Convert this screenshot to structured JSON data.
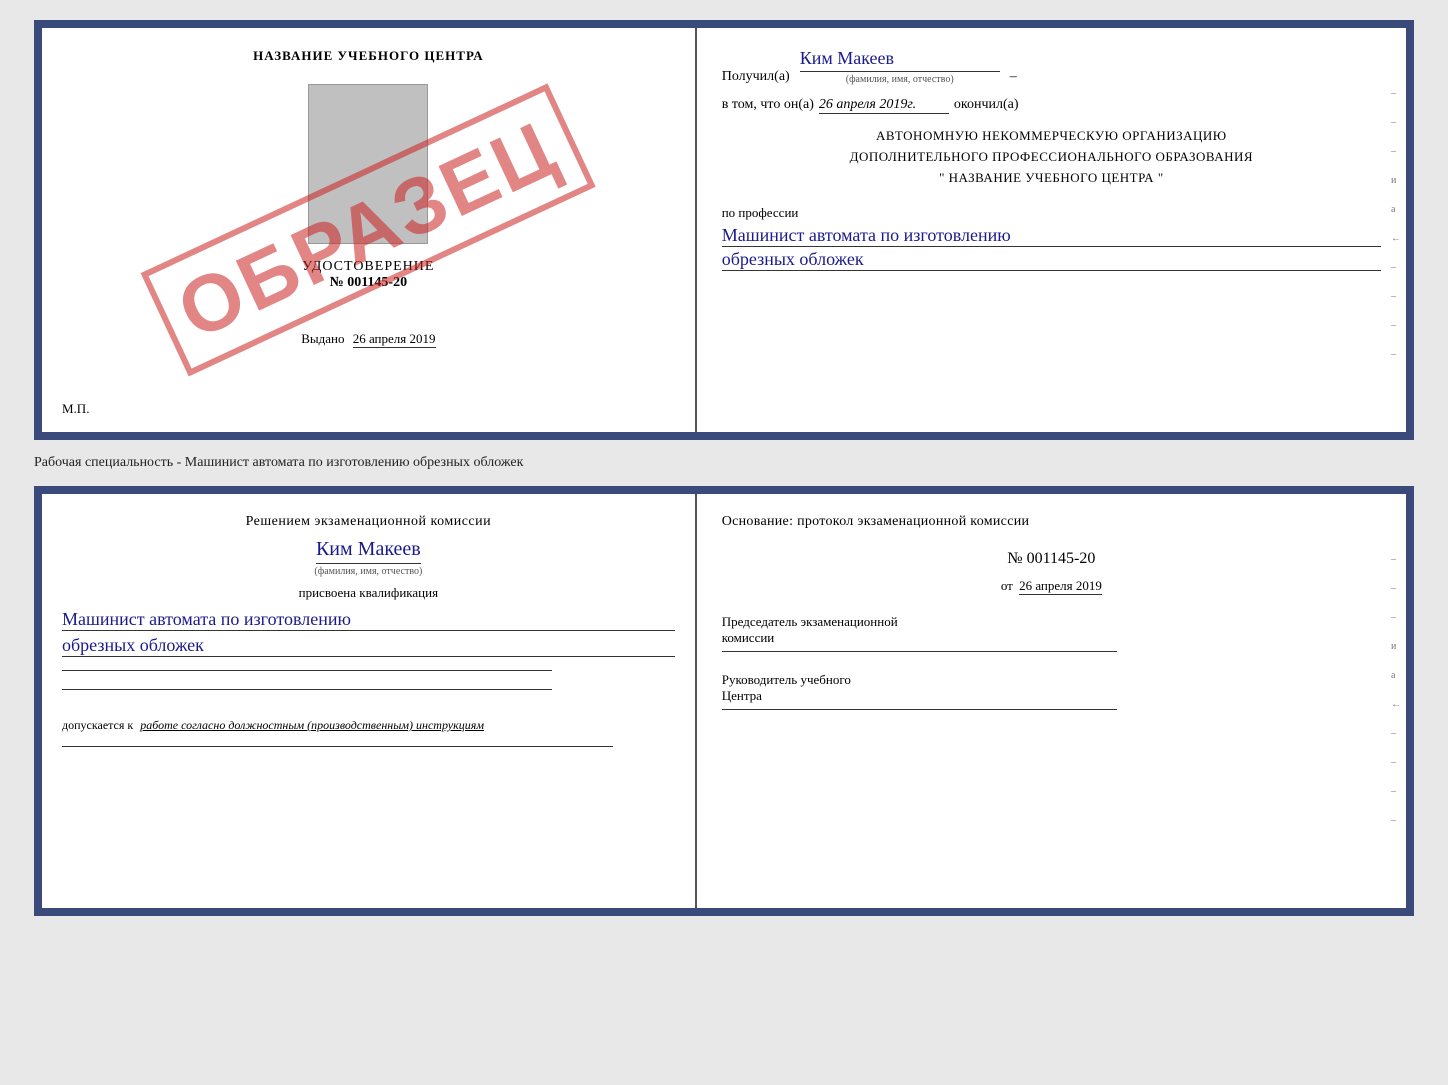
{
  "top_cert": {
    "left": {
      "school_name": "НАЗВАНИЕ УЧЕБНОГО ЦЕНТРА",
      "photo_alt": "Фото",
      "udostoverenie_title": "УДОСТОВЕРЕНИЕ",
      "udostoverenie_number": "№ 001145-20",
      "vydano_label": "Выдано",
      "vydano_date": "26 апреля 2019",
      "mp_label": "М.П.",
      "stamp_text": "ОБРАЗЕЦ"
    },
    "right": {
      "poluchil_label": "Получил(а)",
      "poluchil_name": "Ким Макеев",
      "fio_label": "(фамилия, имя, отчество)",
      "v_tom_text": "в том, что он(а)",
      "date_value": "26 апреля 2019г.",
      "okonchil_label": "окончил(а)",
      "org_line1": "АВТОНОМНУЮ НЕКОММЕРЧЕСКУЮ ОРГАНИЗАЦИЮ",
      "org_line2": "ДОПОЛНИТЕЛЬНОГО ПРОФЕССИОНАЛЬНОГО ОБРАЗОВАНИЯ",
      "org_line3": "\"  НАЗВАНИЕ УЧЕБНОГО ЦЕНТРА  \"",
      "po_professii_label": "по профессии",
      "profession_line1": "Машинист автомата по изготовлению",
      "profession_line2": "обрезных обложек",
      "deco_right": [
        "–",
        "–",
        "–",
        "и",
        "а",
        "←",
        "–",
        "–",
        "–",
        "–"
      ]
    }
  },
  "middle_label": "Рабочая специальность - Машинист автомата по изготовлению обрезных обложек",
  "bottom_cert": {
    "left": {
      "resheniem_text": "Решением экзаменационной комиссии",
      "person_name": "Ким Макеев",
      "fio_label": "(фамилия, имя, отчество)",
      "prisvoena_label": "присвоена квалификация",
      "qualification_line1": "Машинист автомата по изготовлению",
      "qualification_line2": "обрезных обложек",
      "dopuskaetsya_prefix": "допускается к",
      "dopuskaetsya_text": "работе согласно должностным (производственным) инструкциям"
    },
    "right": {
      "osnovanie_text": "Основание: протокол экзаменационной комиссии",
      "protocol_number": "№ 001145-20",
      "ot_label": "от",
      "ot_date": "26 апреля 2019",
      "predsedatel_line1": "Председатель экзаменационной",
      "predsedatel_line2": "комиссии",
      "rukovoditel_line1": "Руководитель учебного",
      "rukovoditel_line2": "Центра",
      "deco_right": [
        "–",
        "–",
        "–",
        "и",
        "а",
        "←",
        "–",
        "–",
        "–",
        "–"
      ]
    }
  }
}
